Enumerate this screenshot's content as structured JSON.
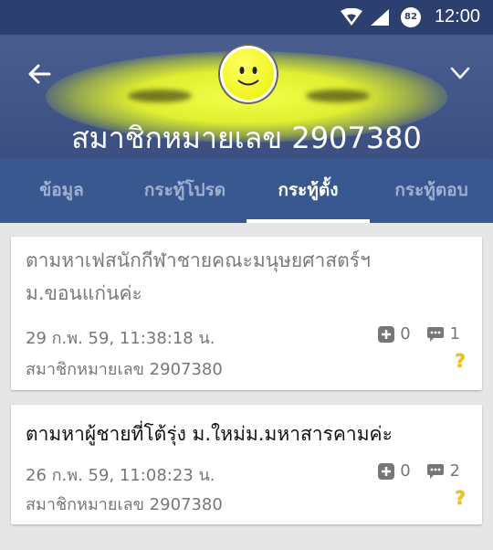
{
  "statusbar": {
    "time": "12:00",
    "battery": "82"
  },
  "header": {
    "title": "สมาชิกหมายเลข 2907380"
  },
  "tabs": [
    {
      "label": "ข้อมูล"
    },
    {
      "label": "กระทู้โปรด"
    },
    {
      "label": "กระทู้ตั้ง",
      "active": true
    },
    {
      "label": "กระทู้ตอบ"
    }
  ],
  "posts": [
    {
      "title_line1": "ตามหาเฟสนักกีฬาชายคณะมนุษยศาสตร์ฯ",
      "title_line2": "ม.ขอนแก่นค่ะ",
      "date": "29 ก.พ. 59,  11:38:18 น.",
      "plus_count": "0",
      "comment_count": "1",
      "author": "สมาชิกหมายเลข 2907380",
      "badge": "?"
    },
    {
      "title_line1": "ตามหาผู้ชายที่โต้รุ่ง ม.ใหม่ม.มหาสารคามค่ะ",
      "date": "26 ก.พ. 59,  11:08:23 น.",
      "plus_count": "0",
      "comment_count": "2",
      "author": "สมาชิกหมายเลข 2907380",
      "badge": "?"
    }
  ],
  "colors": {
    "header": "#3b4f82",
    "tabs": "#3a5890",
    "badge": "#f1c40f"
  }
}
